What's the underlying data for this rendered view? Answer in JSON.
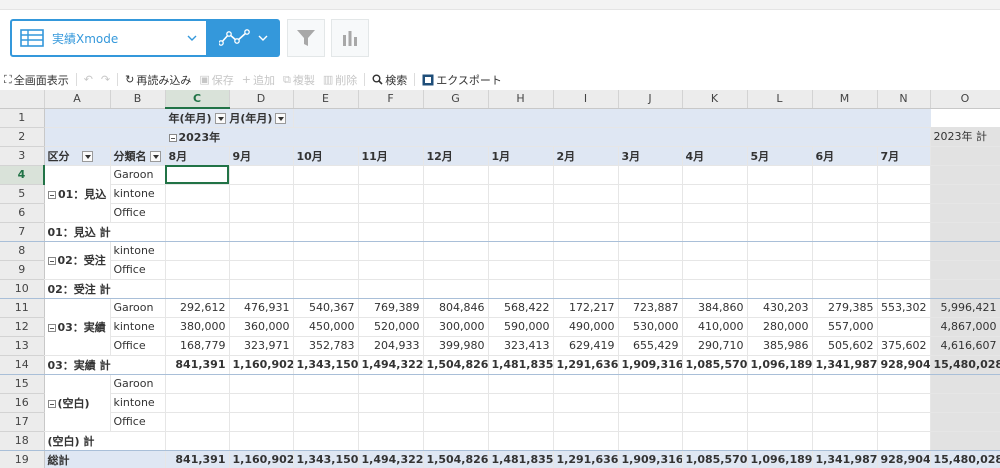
{
  "view": {
    "name": "実績Xmode"
  },
  "toolbar": {
    "fullscreen": "全画面表示",
    "reload": "再読み込み",
    "save": "保存",
    "add": "追加",
    "copy": "複製",
    "delete": "削除",
    "search": "検索",
    "export": "エクスポート"
  },
  "columns": [
    "A",
    "B",
    "C",
    "D",
    "E",
    "F",
    "G",
    "H",
    "I",
    "J",
    "K",
    "L",
    "M",
    "N",
    "O"
  ],
  "pivot": {
    "col_field1": "年(年月)",
    "col_field2": "月(年月)",
    "year": "2023年",
    "year_total": "2023年 計",
    "row_field1": "区分",
    "row_field2": "分類名",
    "months": [
      "8月",
      "9月",
      "10月",
      "11月",
      "12月",
      "1月",
      "2月",
      "3月",
      "4月",
      "5月",
      "6月",
      "7月"
    ]
  },
  "groups": {
    "g1": {
      "name": "01：見込",
      "items": [
        "Garoon",
        "kintone",
        "Office"
      ],
      "subtotal": "01：見込 計"
    },
    "g2": {
      "name": "02：受注",
      "items": [
        "kintone",
        "Office"
      ],
      "subtotal": "02：受注 計"
    },
    "g3": {
      "name": "03：実績",
      "subtotal": "03：実績 計",
      "rows": [
        {
          "item": "Garoon",
          "values": [
            "292,612",
            "476,931",
            "540,367",
            "769,389",
            "804,846",
            "568,422",
            "172,217",
            "723,887",
            "384,860",
            "430,203",
            "279,385",
            "553,302"
          ],
          "total": "5,996,421"
        },
        {
          "item": "kintone",
          "values": [
            "380,000",
            "360,000",
            "450,000",
            "520,000",
            "300,000",
            "590,000",
            "490,000",
            "530,000",
            "410,000",
            "280,000",
            "557,000",
            ""
          ],
          "total": "4,867,000"
        },
        {
          "item": "Office",
          "values": [
            "168,779",
            "323,971",
            "352,783",
            "204,933",
            "399,980",
            "323,413",
            "629,419",
            "655,429",
            "290,710",
            "385,986",
            "505,602",
            "375,602"
          ],
          "total": "4,616,607"
        }
      ],
      "sub_values": [
        "841,391",
        "1,160,902",
        "1,343,150",
        "1,494,322",
        "1,504,826",
        "1,481,835",
        "1,291,636",
        "1,909,316",
        "1,085,570",
        "1,096,189",
        "1,341,987",
        "928,904"
      ],
      "sub_total": "15,480,028"
    },
    "g4": {
      "name": "(空白)",
      "items": [
        "Garoon",
        "kintone",
        "Office"
      ],
      "subtotal": "(空白) 計"
    }
  },
  "grand": {
    "label": "総計",
    "values": [
      "841,391",
      "1,160,902",
      "1,343,150",
      "1,494,322",
      "1,504,826",
      "1,481,835",
      "1,291,636",
      "1,909,316",
      "1,085,570",
      "1,096,189",
      "1,341,987",
      "928,904"
    ],
    "total": "15,480,028"
  },
  "rows": [
    "1",
    "2",
    "3",
    "4",
    "5",
    "6",
    "7",
    "8",
    "9",
    "10",
    "11",
    "12",
    "13",
    "14",
    "15",
    "16",
    "17",
    "18",
    "19"
  ]
}
